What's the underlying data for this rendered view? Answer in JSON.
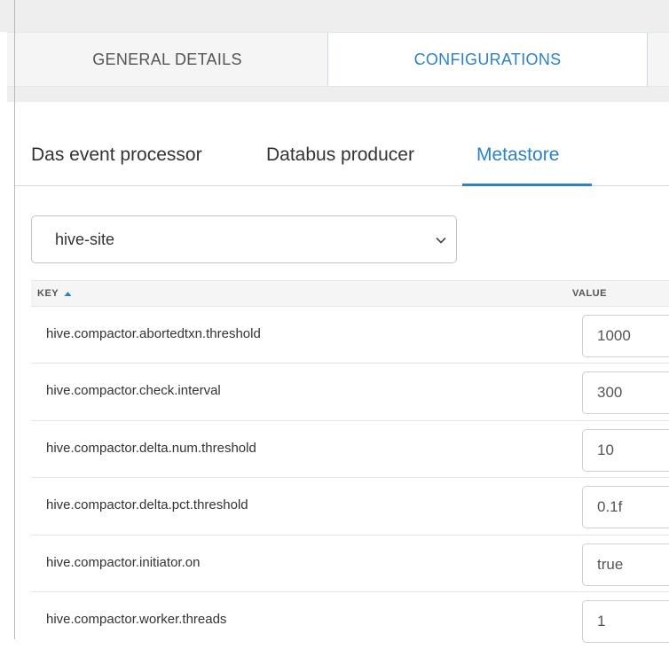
{
  "main_tabs": [
    {
      "label": "GENERAL DETAILS",
      "active": false
    },
    {
      "label": "CONFIGURATIONS",
      "active": true
    }
  ],
  "sub_tabs": [
    {
      "label": "Das event processor",
      "active": false
    },
    {
      "label": "Databus producer",
      "active": false
    },
    {
      "label": "Metastore",
      "active": true
    }
  ],
  "config_select": {
    "value": "hive-site"
  },
  "table": {
    "headers": {
      "key": "KEY",
      "value": "VALUE"
    },
    "sort": {
      "column": "key",
      "direction": "ascending"
    },
    "rows": [
      {
        "key": "hive.compactor.abortedtxn.threshold",
        "value": "1000"
      },
      {
        "key": "hive.compactor.check.interval",
        "value": "300"
      },
      {
        "key": "hive.compactor.delta.num.threshold",
        "value": "10"
      },
      {
        "key": "hive.compactor.delta.pct.threshold",
        "value": "0.1f"
      },
      {
        "key": "hive.compactor.initiator.on",
        "value": "true"
      },
      {
        "key": "hive.compactor.worker.threads",
        "value": "1"
      }
    ]
  },
  "colors": {
    "accent": "#2b82c9",
    "text": "#333333",
    "header_bg": "#f5f5f5"
  },
  "icons": {
    "select": "chevron-down-icon",
    "sort": "sort-ascending-icon"
  }
}
